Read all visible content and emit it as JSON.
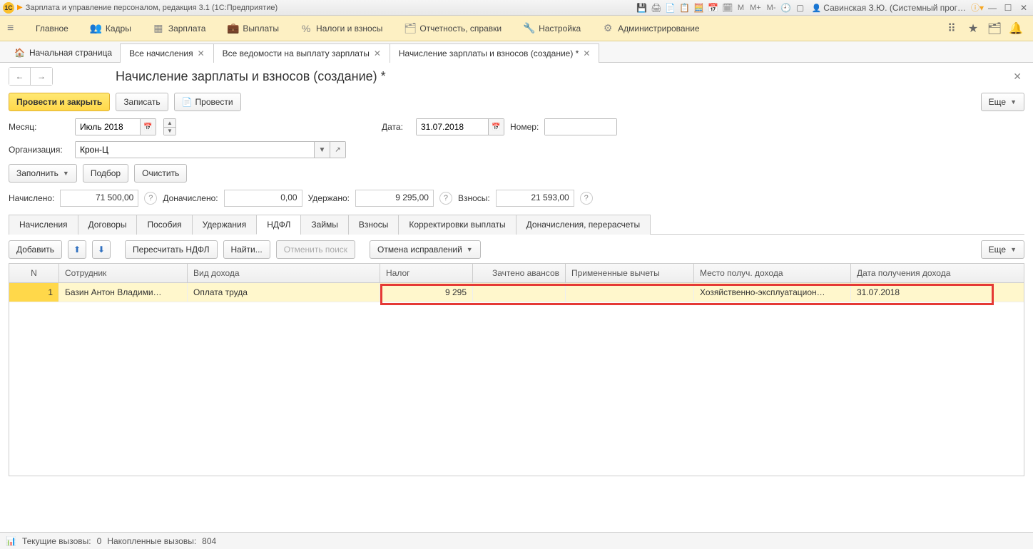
{
  "titlebar": {
    "logo": "1C",
    "title": "Зарплата и управление персоналом, редакция 3.1  (1С:Предприятие)",
    "m_btns": [
      "M",
      "M+",
      "M-"
    ],
    "user": "Савинская З.Ю. (Системный прог…"
  },
  "menu": {
    "items": [
      {
        "icon": "≡",
        "label": "Главное"
      },
      {
        "icon": "👥",
        "label": "Кадры"
      },
      {
        "icon": "▦",
        "label": "Зарплата"
      },
      {
        "icon": "💼",
        "label": "Выплаты"
      },
      {
        "icon": "%",
        "label": "Налоги и взносы"
      },
      {
        "icon": "🗂",
        "label": "Отчетность, справки"
      },
      {
        "icon": "🔧",
        "label": "Настройка"
      },
      {
        "icon": "⚙",
        "label": "Администрирование"
      }
    ]
  },
  "tabs": {
    "home": "Начальная страница",
    "items": [
      "Все начисления",
      "Все ведомости на выплату зарплаты",
      "Начисление зарплаты и взносов (создание) *"
    ]
  },
  "page": {
    "title": "Начисление зарплаты и взносов (создание) *",
    "buttons": {
      "post_close": "Провести и закрыть",
      "write": "Записать",
      "post": "Провести",
      "more": "Еще"
    },
    "fields": {
      "month_label": "Месяц:",
      "month_value": "Июль 2018",
      "date_label": "Дата:",
      "date_value": "31.07.2018",
      "number_label": "Номер:",
      "number_value": "",
      "org_label": "Организация:",
      "org_value": "Крон-Ц"
    },
    "actions": {
      "fill": "Заполнить",
      "pick": "Подбор",
      "clear": "Очистить"
    },
    "totals": {
      "accrued_label": "Начислено:",
      "accrued": "71 500,00",
      "extra_label": "Доначислено:",
      "extra": "0,00",
      "withheld_label": "Удержано:",
      "withheld": "9 295,00",
      "contrib_label": "Взносы:",
      "contrib": "21 593,00"
    },
    "doc_tabs": [
      "Начисления",
      "Договоры",
      "Пособия",
      "Удержания",
      "НДФЛ",
      "Займы",
      "Взносы",
      "Корректировки выплаты",
      "Доначисления, перерасчеты"
    ],
    "active_doc_tab": 4,
    "table_tools": {
      "add": "Добавить",
      "recalc": "Пересчитать НДФЛ",
      "find": "Найти...",
      "cancel_search": "Отменить поиск",
      "cancel_fix": "Отмена исправлений",
      "more": "Еще"
    },
    "grid": {
      "headers": [
        "N",
        "Сотрудник",
        "Вид дохода",
        "Налог",
        "Зачтено авансов",
        "Примененные вычеты",
        "Место получ. дохода",
        "Дата получения дохода"
      ],
      "rows": [
        {
          "n": "1",
          "emp": "Базин Антон Владими…",
          "kind": "Оплата труда",
          "tax": "9 295",
          "advance": "",
          "deduct": "",
          "place": "Хозяйственно-эксплуатацион…",
          "date": "31.07.2018"
        }
      ]
    }
  },
  "status": {
    "current_label": "Текущие вызовы:",
    "current": "0",
    "accum_label": "Накопленные вызовы:",
    "accum": "804"
  }
}
